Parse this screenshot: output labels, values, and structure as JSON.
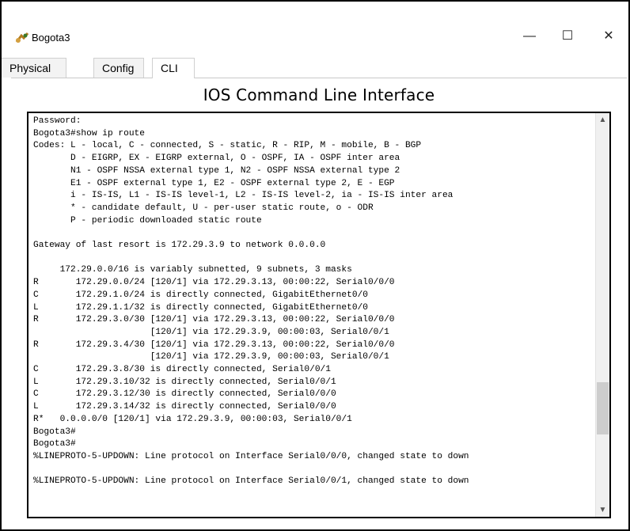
{
  "window": {
    "title": "Bogota3",
    "minimize_glyph": "—",
    "maximize_glyph": "☐",
    "close_glyph": "✕",
    "icon": "router-icon"
  },
  "tabs": [
    {
      "label": "Physical"
    },
    {
      "label": "Config"
    },
    {
      "label": "CLI",
      "active": true
    }
  ],
  "cli": {
    "heading": "IOS Command Line Interface",
    "output": "Password:\nBogota3#show ip route\nCodes: L - local, C - connected, S - static, R - RIP, M - mobile, B - BGP\n       D - EIGRP, EX - EIGRP external, O - OSPF, IA - OSPF inter area\n       N1 - OSPF NSSA external type 1, N2 - OSPF NSSA external type 2\n       E1 - OSPF external type 1, E2 - OSPF external type 2, E - EGP\n       i - IS-IS, L1 - IS-IS level-1, L2 - IS-IS level-2, ia - IS-IS inter area\n       * - candidate default, U - per-user static route, o - ODR\n       P - periodic downloaded static route\n\nGateway of last resort is 172.29.3.9 to network 0.0.0.0\n\n     172.29.0.0/16 is variably subnetted, 9 subnets, 3 masks\nR       172.29.0.0/24 [120/1] via 172.29.3.13, 00:00:22, Serial0/0/0\nC       172.29.1.0/24 is directly connected, GigabitEthernet0/0\nL       172.29.1.1/32 is directly connected, GigabitEthernet0/0\nR       172.29.3.0/30 [120/1] via 172.29.3.13, 00:00:22, Serial0/0/0\n                      [120/1] via 172.29.3.9, 00:00:03, Serial0/0/1\nR       172.29.3.4/30 [120/1] via 172.29.3.13, 00:00:22, Serial0/0/0\n                      [120/1] via 172.29.3.9, 00:00:03, Serial0/0/1\nC       172.29.3.8/30 is directly connected, Serial0/0/1\nL       172.29.3.10/32 is directly connected, Serial0/0/1\nC       172.29.3.12/30 is directly connected, Serial0/0/0\nL       172.29.3.14/32 is directly connected, Serial0/0/0\nR*   0.0.0.0/0 [120/1] via 172.29.3.9, 00:00:03, Serial0/0/1\nBogota3#\nBogota3#\n%LINEPROTO-5-UPDOWN: Line protocol on Interface Serial0/0/0, changed state to down\n\n%LINEPROTO-5-UPDOWN: Line protocol on Interface Serial0/0/1, changed state to down"
  },
  "colors": {
    "border": "#000000",
    "background": "#ffffff",
    "scrollbar": "#f0f0f0",
    "thumb": "#cdcdcd"
  }
}
